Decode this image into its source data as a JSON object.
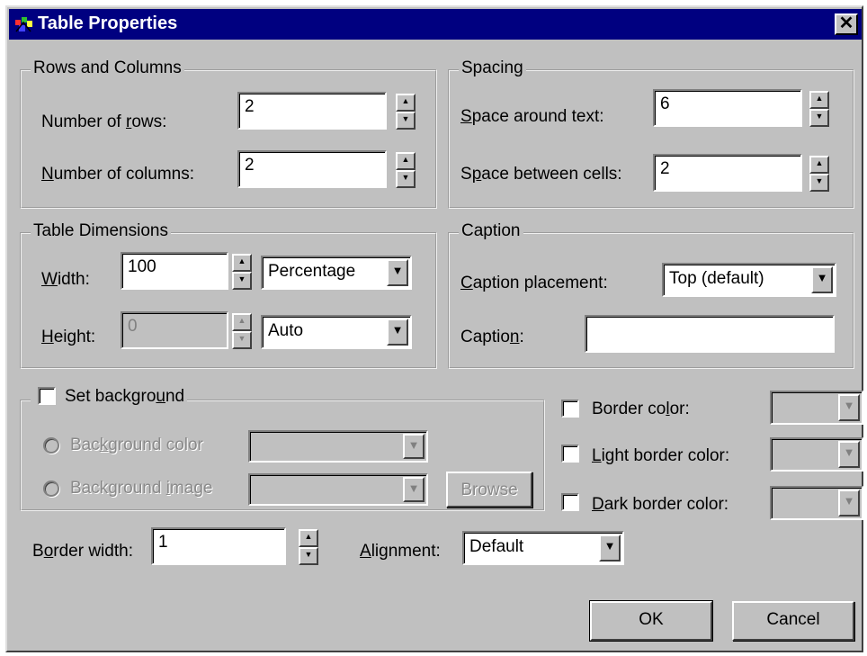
{
  "window": {
    "title": "Table Properties"
  },
  "rows_columns": {
    "legend": "Rows and Columns",
    "rows_label": "Number of rows:",
    "rows_value": "2",
    "columns_label": "Number of columns:",
    "columns_value": "2"
  },
  "spacing": {
    "legend": "Spacing",
    "around_label": "Space around text:",
    "around_value": "6",
    "between_label": "Space between cells:",
    "between_value": "2"
  },
  "dimensions": {
    "legend": "Table Dimensions",
    "width_label": "Width:",
    "width_value": "100",
    "width_unit": "Percentage",
    "height_label": "Height:",
    "height_value": "0",
    "height_unit": "Auto"
  },
  "caption": {
    "legend": "Caption",
    "placement_label": "Caption placement:",
    "placement_value": "Top (default)",
    "caption_label": "Caption:",
    "caption_value": ""
  },
  "background": {
    "set_label": "Set background",
    "color_label": "Background color",
    "image_label": "Background image",
    "browse_label": "Browse"
  },
  "borders": {
    "border_color_label": "Border color:",
    "light_label": "Light border color:",
    "dark_label": "Dark border color:",
    "width_label": "Border width:",
    "width_value": "1",
    "alignment_label": "Alignment:",
    "alignment_value": "Default"
  },
  "buttons": {
    "ok": "OK",
    "cancel": "Cancel"
  },
  "colors": {
    "face": "#c0c0c0",
    "titlebar": "#000080"
  }
}
